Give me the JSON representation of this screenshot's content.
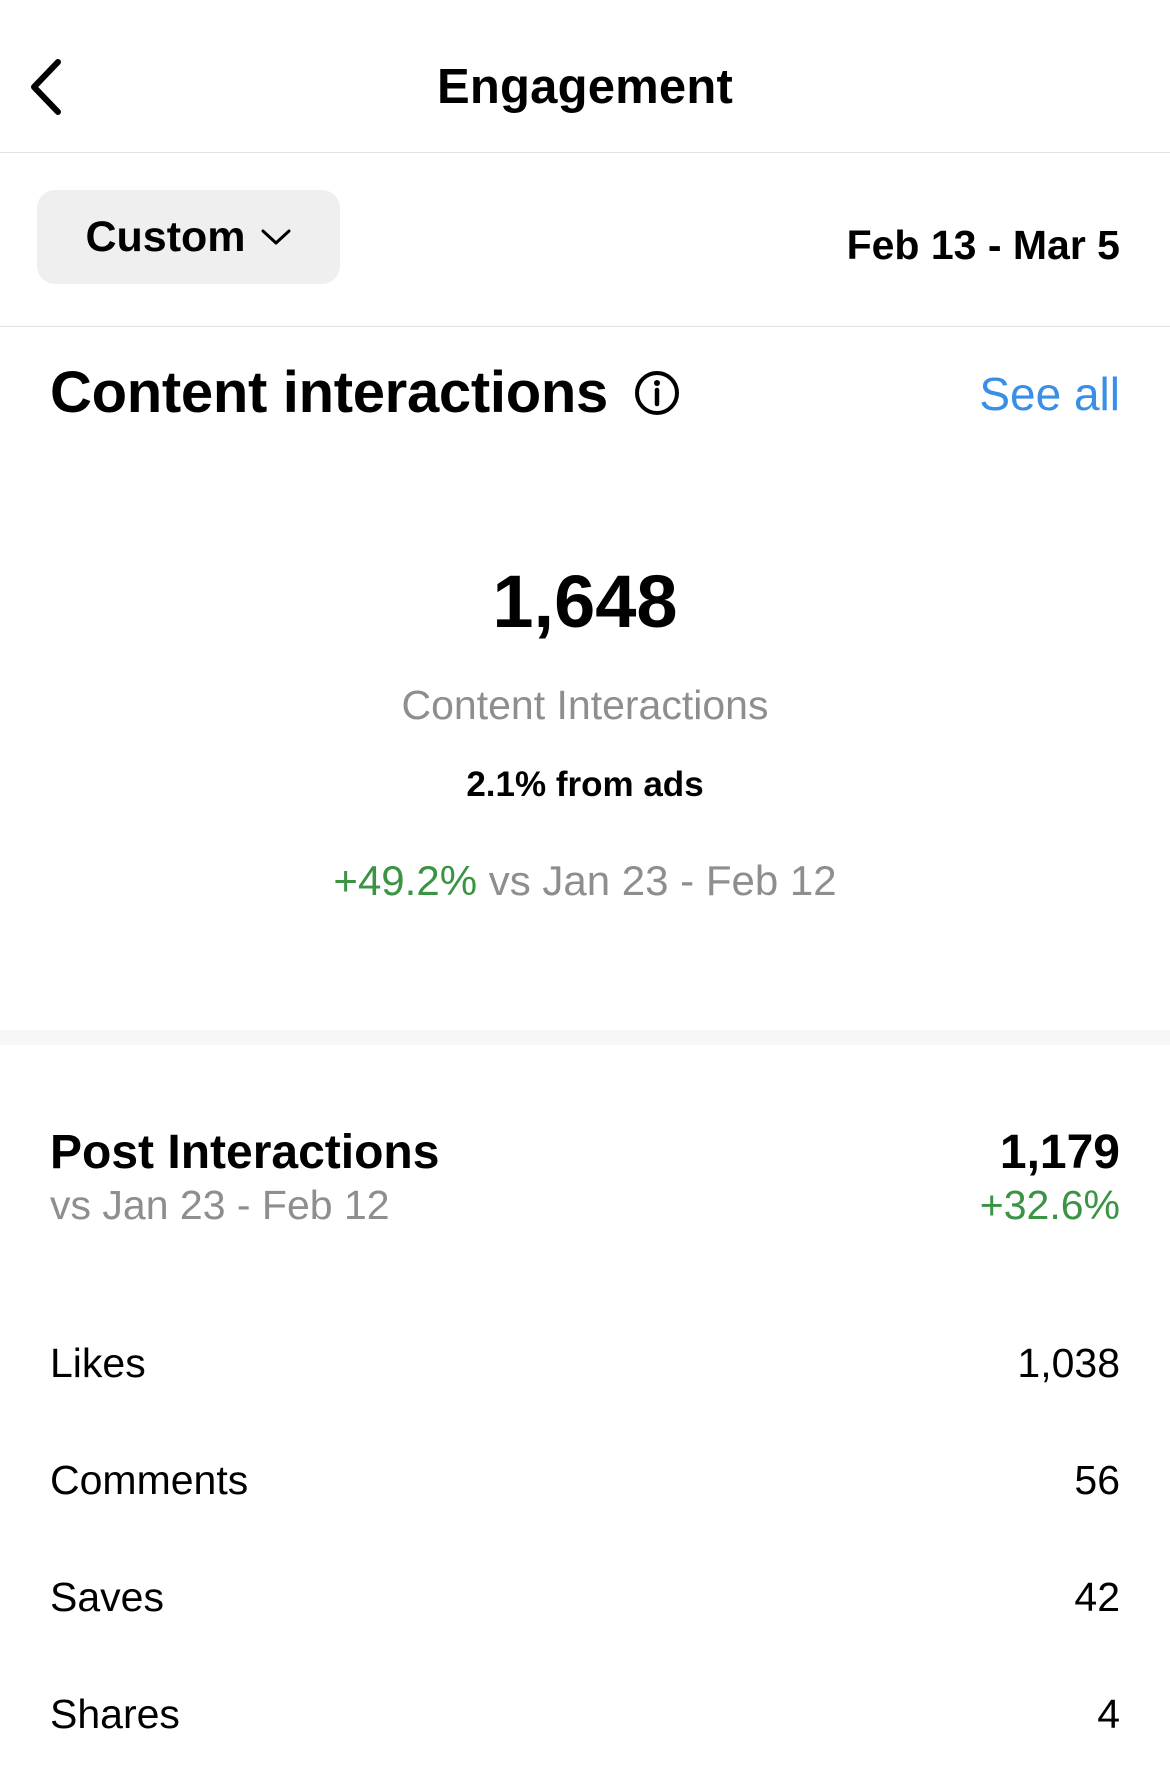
{
  "header": {
    "title": "Engagement",
    "back_icon": "chevron-left-icon"
  },
  "filter": {
    "period_label": "Custom",
    "period_icon": "chevron-down-icon",
    "date_range": "Feb 13 - Mar 5"
  },
  "content_interactions": {
    "title": "Content interactions",
    "info_icon": "info-icon",
    "see_all_label": "See all",
    "total": "1,648",
    "total_label": "Content Interactions",
    "from_ads": "2.1% from ads",
    "change": "+49.2%",
    "compare_text": "vs Jan 23 - Feb 12"
  },
  "post_interactions": {
    "title": "Post Interactions",
    "compare_text": "vs Jan 23 - Feb 12",
    "total": "1,179",
    "change": "+32.6%",
    "metrics": [
      {
        "label": "Likes",
        "value": "1,038"
      },
      {
        "label": "Comments",
        "value": "56"
      },
      {
        "label": "Saves",
        "value": "42"
      },
      {
        "label": "Shares",
        "value": "4"
      }
    ]
  },
  "colors": {
    "link": "#3a8ee6",
    "positive": "#3a9444",
    "muted": "#8e8e8e",
    "button_bg": "#efefef"
  }
}
